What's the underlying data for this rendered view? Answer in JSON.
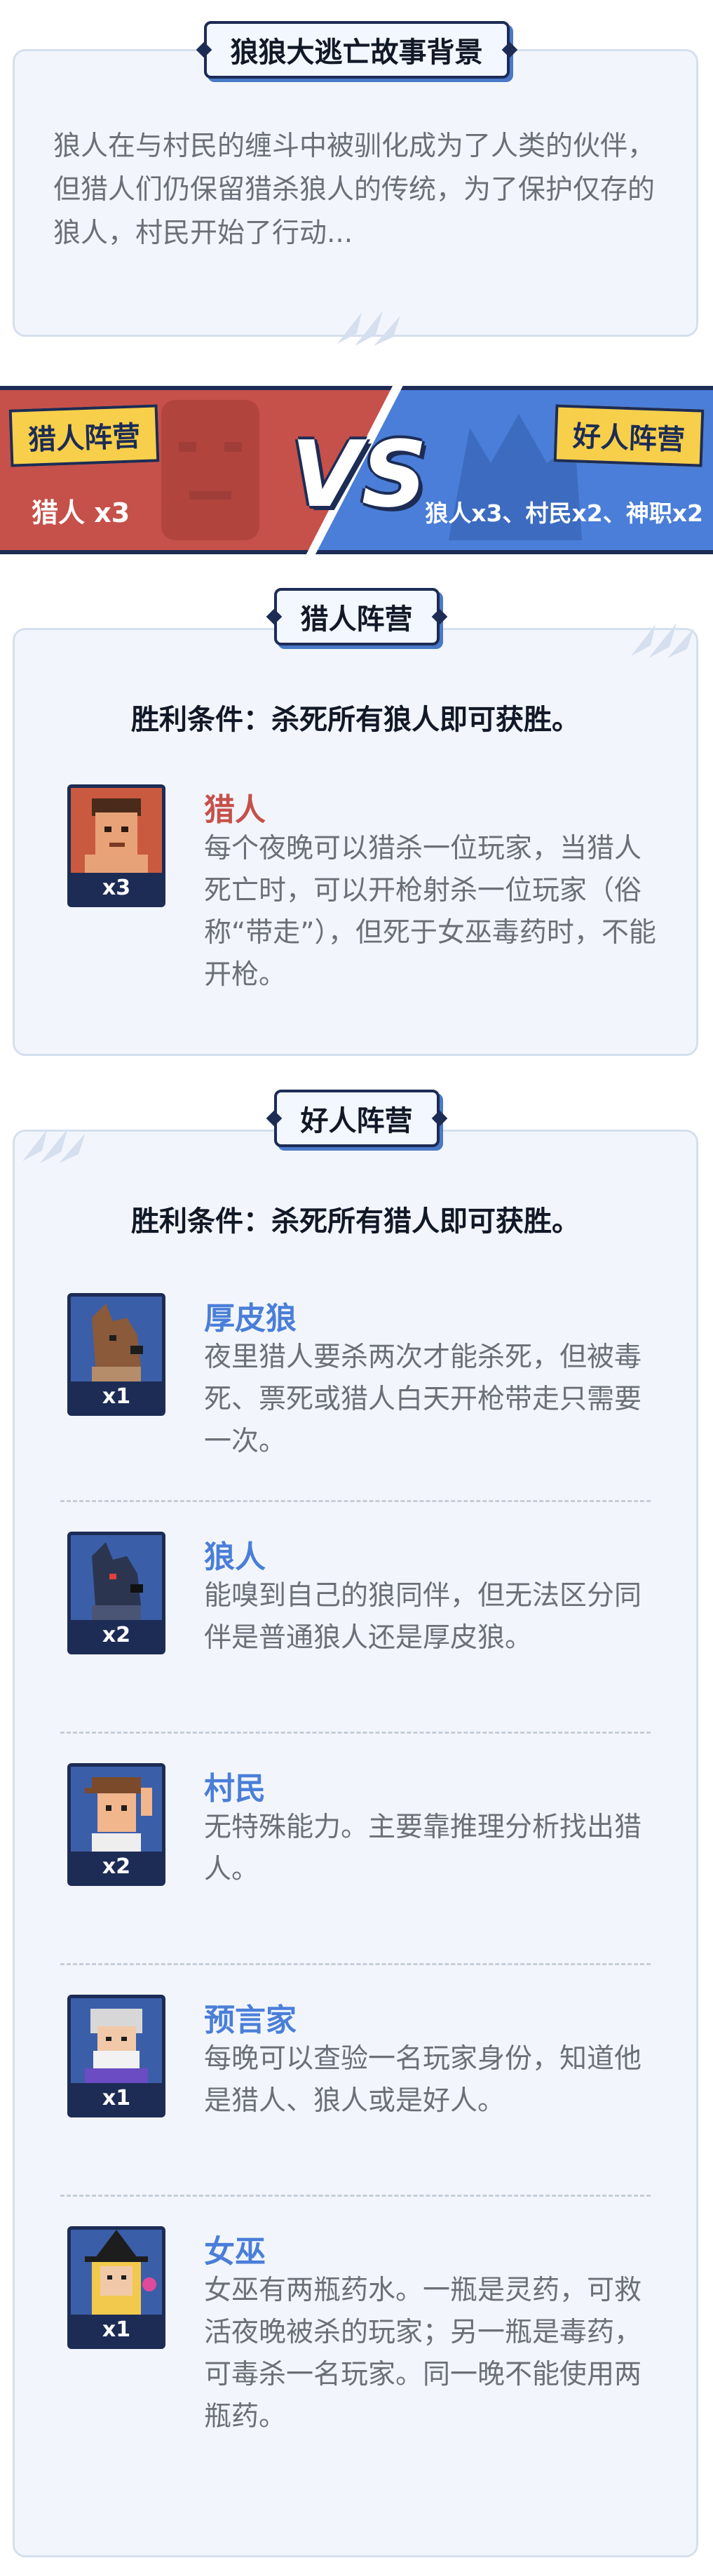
{
  "story": {
    "title": "狼狼大逃亡故事背景",
    "text": "狼人在与村民的缠斗中被驯化成为了人类的伙伴，但猎人们仍保留猎杀狼人的传统，为了保护仅存的狼人，村民开始了行动..."
  },
  "versus": {
    "left_tag": "猎人阵营",
    "left_count": "猎人 x3",
    "right_tag": "好人阵营",
    "right_count": "狼人x3、村民x2、神职x2",
    "vs_text": "VS"
  },
  "hunter_camp": {
    "title": "猎人阵营",
    "win_condition": "胜利条件：杀死所有狼人即可获胜。",
    "roles": [
      {
        "name": "猎人",
        "count": "x3",
        "description": "每个夜晚可以猎杀一位玩家，当猎人死亡时，可以开枪射杀一位玩家（俗称“带走”），但死于女巫毒药时，不能开枪。"
      }
    ]
  },
  "good_camp": {
    "title": "好人阵营",
    "win_condition": "胜利条件：杀死所有猎人即可获胜。",
    "roles": [
      {
        "name": "厚皮狼",
        "count": "x1",
        "description": "夜里猎人要杀两次才能杀死，但被毒死、票死或猎人白天开枪带走只需要一次。"
      },
      {
        "name": "狼人",
        "count": "x2",
        "description": "能嗅到自己的狼同伴，但无法区分同伴是普通狼人还是厚皮狼。"
      },
      {
        "name": "村民",
        "count": "x2",
        "description": "无特殊能力。主要靠推理分析找出猎人。"
      },
      {
        "name": "预言家",
        "count": "x1",
        "description": "每晚可以查验一名玩家身份，知道他是猎人、狼人或是好人。"
      },
      {
        "name": "女巫",
        "count": "x1",
        "description": "女巫有两瓶药水。一瓶是灵药，可救活夜晚被杀的玩家；另一瓶是毒药，可毒杀一名玩家。同一晚不能使用两瓶药。"
      }
    ]
  },
  "colors": {
    "hunter_red": "#c6504a",
    "good_blue": "#4a7ed8",
    "navy": "#1d2c55",
    "tag_yellow": "#f7cf4a"
  }
}
